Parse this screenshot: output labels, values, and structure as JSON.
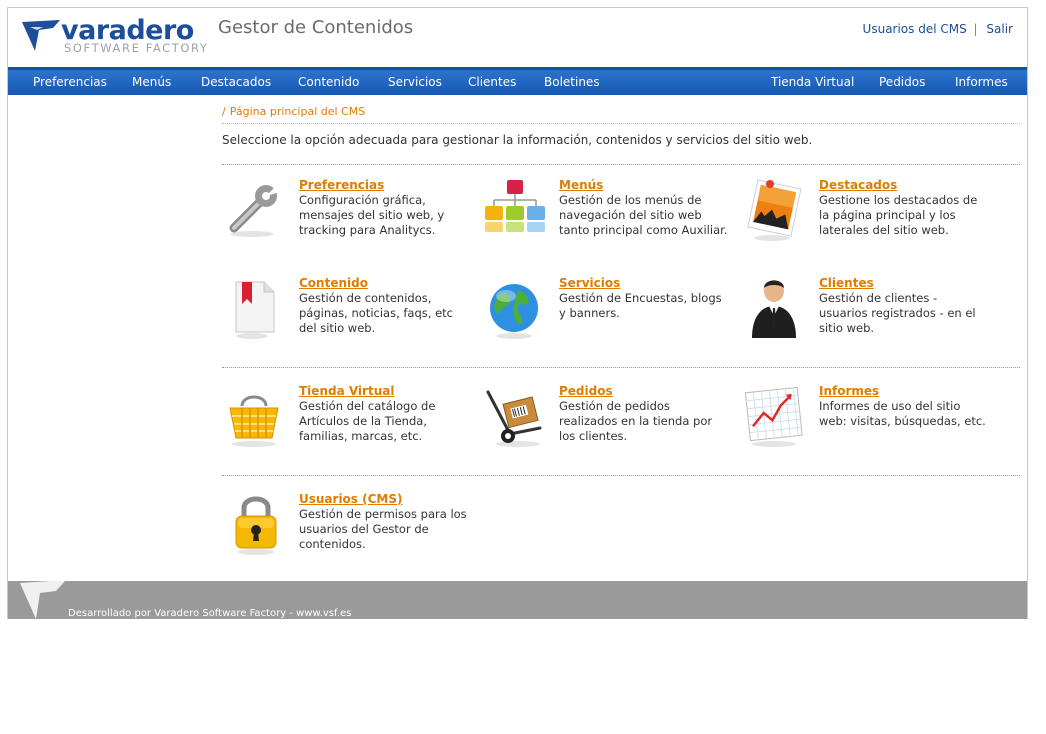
{
  "brand": {
    "logo_word": "varadero",
    "logo_sub": "SOFTWARE FACTORY",
    "app_title": "Gestor de Contenidos"
  },
  "top_links": {
    "users": "Usuarios del CMS",
    "separator": "|",
    "exit": "Salir"
  },
  "nav": {
    "items": [
      "Preferencias",
      "Menús",
      "Destacados",
      "Contenido",
      "Servicios",
      "Clientes",
      "Boletines",
      "Tienda Virtual",
      "Pedidos",
      "Informes"
    ]
  },
  "breadcrumb": {
    "slash": "/",
    "current": "Página principal del CMS"
  },
  "intro": "Seleccione la opción adecuada para gestionar la información, contenidos y servicios del sitio web.",
  "modules": [
    {
      "title": "Preferencias",
      "desc": "Configuración gráfica, mensajes del sitio web, y tracking para Analitycs.",
      "icon": "wrench-icon"
    },
    {
      "title": "Menús",
      "desc": "Gestión de los menús de navegación del sitio web tanto principal como Auxiliar.",
      "icon": "sitemap-icon"
    },
    {
      "title": "Destacados",
      "desc": "Gestione los destacados de la página principal y los laterales del sitio web.",
      "icon": "pinned-photo-icon"
    },
    {
      "title": "Contenido",
      "desc": "Gestión de contenidos, páginas, noticias, faqs, etc del sitio web.",
      "icon": "bookmarked-document-icon"
    },
    {
      "title": "Servicios",
      "desc": "Gestión de Encuestas, blogs y banners.",
      "icon": "globe-icon"
    },
    {
      "title": "Clientes",
      "desc": "Gestión de clientes - usuarios registrados - en el sitio web.",
      "icon": "businessman-icon"
    },
    {
      "title": "Tienda Virtual",
      "desc": "Gestión del catálogo de Artículos de la Tienda, familias, marcas, etc.",
      "icon": "shopping-basket-icon"
    },
    {
      "title": "Pedidos",
      "desc": "Gestión de pedidos realizados en la tienda por los clientes.",
      "icon": "hand-truck-icon"
    },
    {
      "title": "Informes",
      "desc": "Informes de uso del sitio web: visitas, búsquedas, etc.",
      "icon": "line-chart-icon"
    },
    {
      "title": "Usuarios (CMS)",
      "desc": "Gestión de permisos para los usuarios del Gestor de contenidos.",
      "icon": "padlock-icon"
    }
  ],
  "footer": {
    "text": "Desarrollado por Varadero Software Factory - www.vsf.es"
  },
  "colors": {
    "nav_blue": "#1658b3",
    "brand_blue": "#1d4e9a",
    "accent_orange": "#e07c00",
    "footer_gray": "#9a9a9a"
  }
}
